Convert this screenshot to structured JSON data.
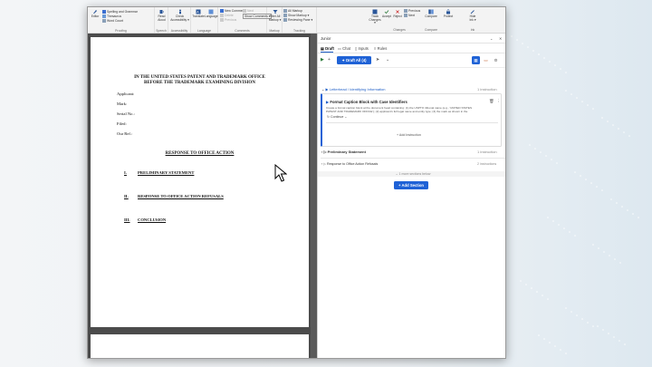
{
  "ribbon": {
    "proofing": {
      "editor": "Editor",
      "spelling": "Spelling and Grammar",
      "thesaurus": "Thesaurus",
      "word_count": "Word Count",
      "label": "Proofing"
    },
    "speech": {
      "read_aloud": "Read Aloud",
      "label": "Speech"
    },
    "accessibility": {
      "check": "Check Accessibility ▾",
      "label": "Accessibility"
    },
    "language": {
      "translate": "Translate",
      "language": "Language",
      "label": "Language"
    },
    "comments": {
      "new_comment": "New Comment",
      "delete": "Delete",
      "previous": "Previous",
      "next": "Next",
      "show_comments": "Show Comments ▾",
      "label": "Comments"
    },
    "markup": {
      "filter_all_markup": "Filter All Markup ▾",
      "label": "Markup"
    },
    "tracking": {
      "all_markup": "All Markup",
      "show_markup": "Show Markup ▾",
      "reviewing_pane": "Reviewing Pane ▾",
      "track_changes": "Track Changes ▾",
      "label": "Tracking"
    },
    "changes": {
      "accept": "Accept",
      "reject": "Reject",
      "previous": "Previous",
      "next": "Next",
      "label": "Changes"
    },
    "compare": {
      "compare": "Compare",
      "label": "Compare"
    },
    "protect": {
      "protect": "Protect"
    },
    "ink": {
      "hide_ink": "Hide Ink ▾",
      "label": "Ink"
    }
  },
  "document": {
    "header_line1": "IN THE UNITED STATES PATENT AND TRADEMARK OFFICE",
    "header_line2": "BEFORE THE TRADEMARK EXAMINING DIVISION",
    "fields": [
      "Applicant:",
      "Mark:",
      "Serial No.:",
      "Filed:",
      "Our Ref.:"
    ],
    "response_title": "RESPONSE TO OFFICE ACTION",
    "sections": [
      {
        "num": "I.",
        "title": "PRELIMINARY STATEMENT"
      },
      {
        "num": "II.",
        "title": "RESPONSE TO OFFICE ACTION REFUSALS"
      },
      {
        "num": "III.",
        "title": "CONCLUSION"
      }
    ]
  },
  "panel": {
    "title": "Junior",
    "tabs": [
      "Draft",
      "Chat",
      "Inputs",
      "Rules"
    ],
    "draft_button": "Draft All (4)",
    "section1": {
      "title": "Letterhead / Identifying Information",
      "count": "1 instruction"
    },
    "card": {
      "title": "Format Caption Block with Case Identifiers",
      "body_line1": "Create a formal caption block at the document head containing: (1) the USPTO tribunal name (e.g., 'UNITED STATES",
      "body_line2": "PATENT AND TRADEMARK OFFICE'); (2) applicant's full legal name and entity type; (3) the mark as shown in the",
      "continue": "Continue",
      "add_instruction": "Add Instruction"
    },
    "section2": {
      "title": "Preliminary Statement",
      "count": "1 instruction"
    },
    "section3": {
      "title": "Response to Office Action Refusals",
      "count": "2 instructions"
    },
    "more_sections": "1 more sections below",
    "add_section": "Add Section"
  }
}
